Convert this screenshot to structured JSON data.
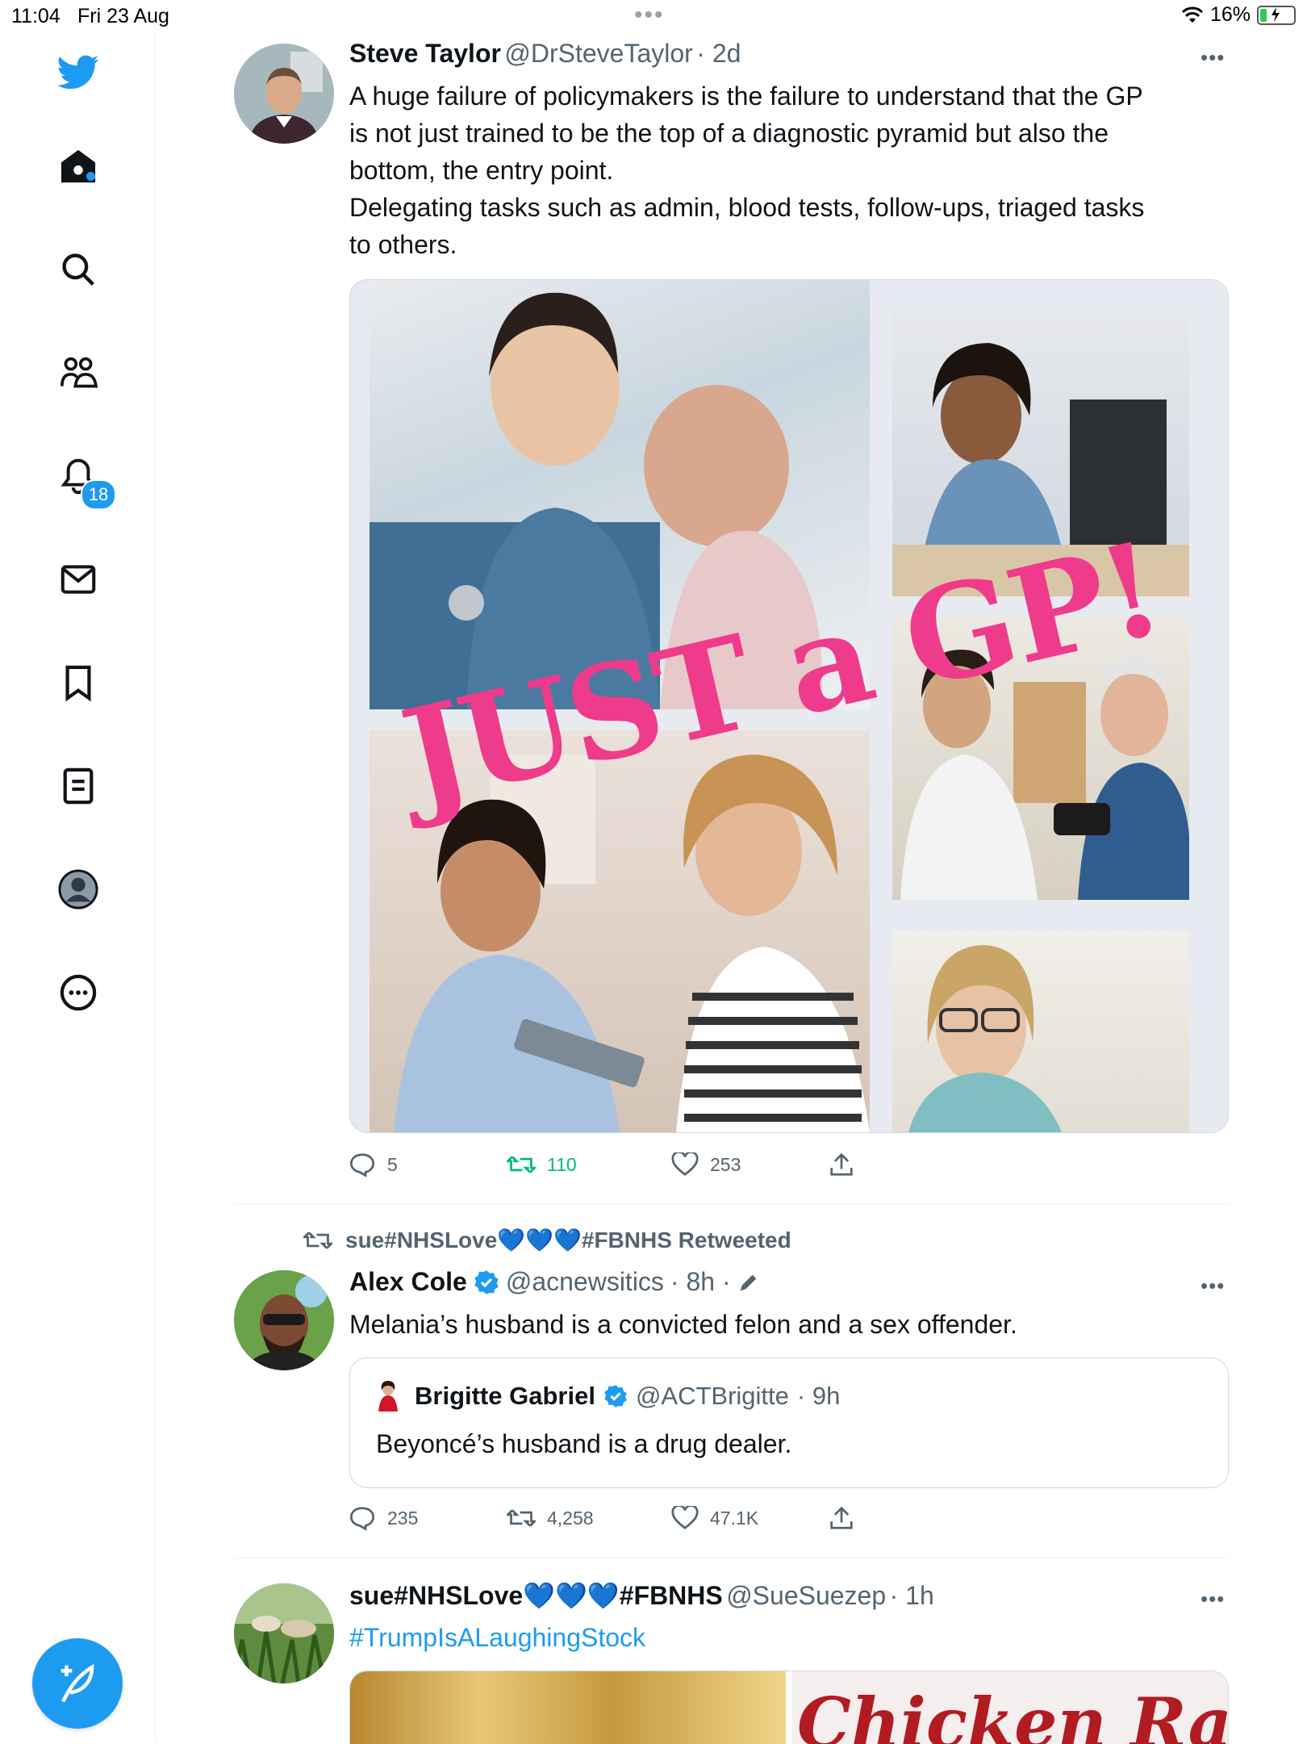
{
  "status_bar": {
    "time": "11:04",
    "date": "Fri 23 Aug",
    "battery": "16%",
    "charging": true
  },
  "sidebar": {
    "notifications_badge": "18",
    "items": [
      "home-icon",
      "explore-icon",
      "communities-icon",
      "notifications-icon",
      "messages-icon",
      "bookmarks-icon",
      "lists-icon",
      "profile-icon",
      "more-icon"
    ]
  },
  "colors": {
    "accent": "#1d9bf0",
    "retweet_green": "#00ba7c",
    "text": "#0f1419",
    "secondary": "#536471"
  },
  "tweets": [
    {
      "name": "Steve Taylor",
      "handle": "@DrSteveTaylor",
      "time": "· 2d",
      "text_lines": [
        "A huge failure of policymakers is the failure to understand that the GP",
        "is not just trained to be the top of a diagnostic pyramid but also the",
        "bottom, the entry point.",
        "Delegating tasks such as admin, blood tests, follow-ups, triaged tasks",
        "to others."
      ],
      "image_overlay": "JUST a GP!",
      "replies": "5",
      "retweets": "110",
      "likes": "253"
    },
    {
      "retweeted_by": "sue#NHSLove💙💙💙#FBNHS Retweeted",
      "name": "Alex Cole",
      "handle": "@acnewsitics",
      "time": "· 8h ·",
      "text": "Melania’s husband is a convicted felon and a sex offender.",
      "quote": {
        "name": "Brigitte Gabriel",
        "handle": "@ACTBrigitte",
        "time": "· 9h",
        "text": "Beyoncé’s husband is a drug dealer."
      },
      "replies": "235",
      "retweets": "4,258",
      "likes": "47.1K"
    },
    {
      "name": "sue#NHSLove💙💙💙#FBNHS",
      "handle": "@SueSuezep",
      "time": "· 1h",
      "text": "#TrumpIsALaughingStock",
      "image_text": "Chicken Ra"
    }
  ]
}
